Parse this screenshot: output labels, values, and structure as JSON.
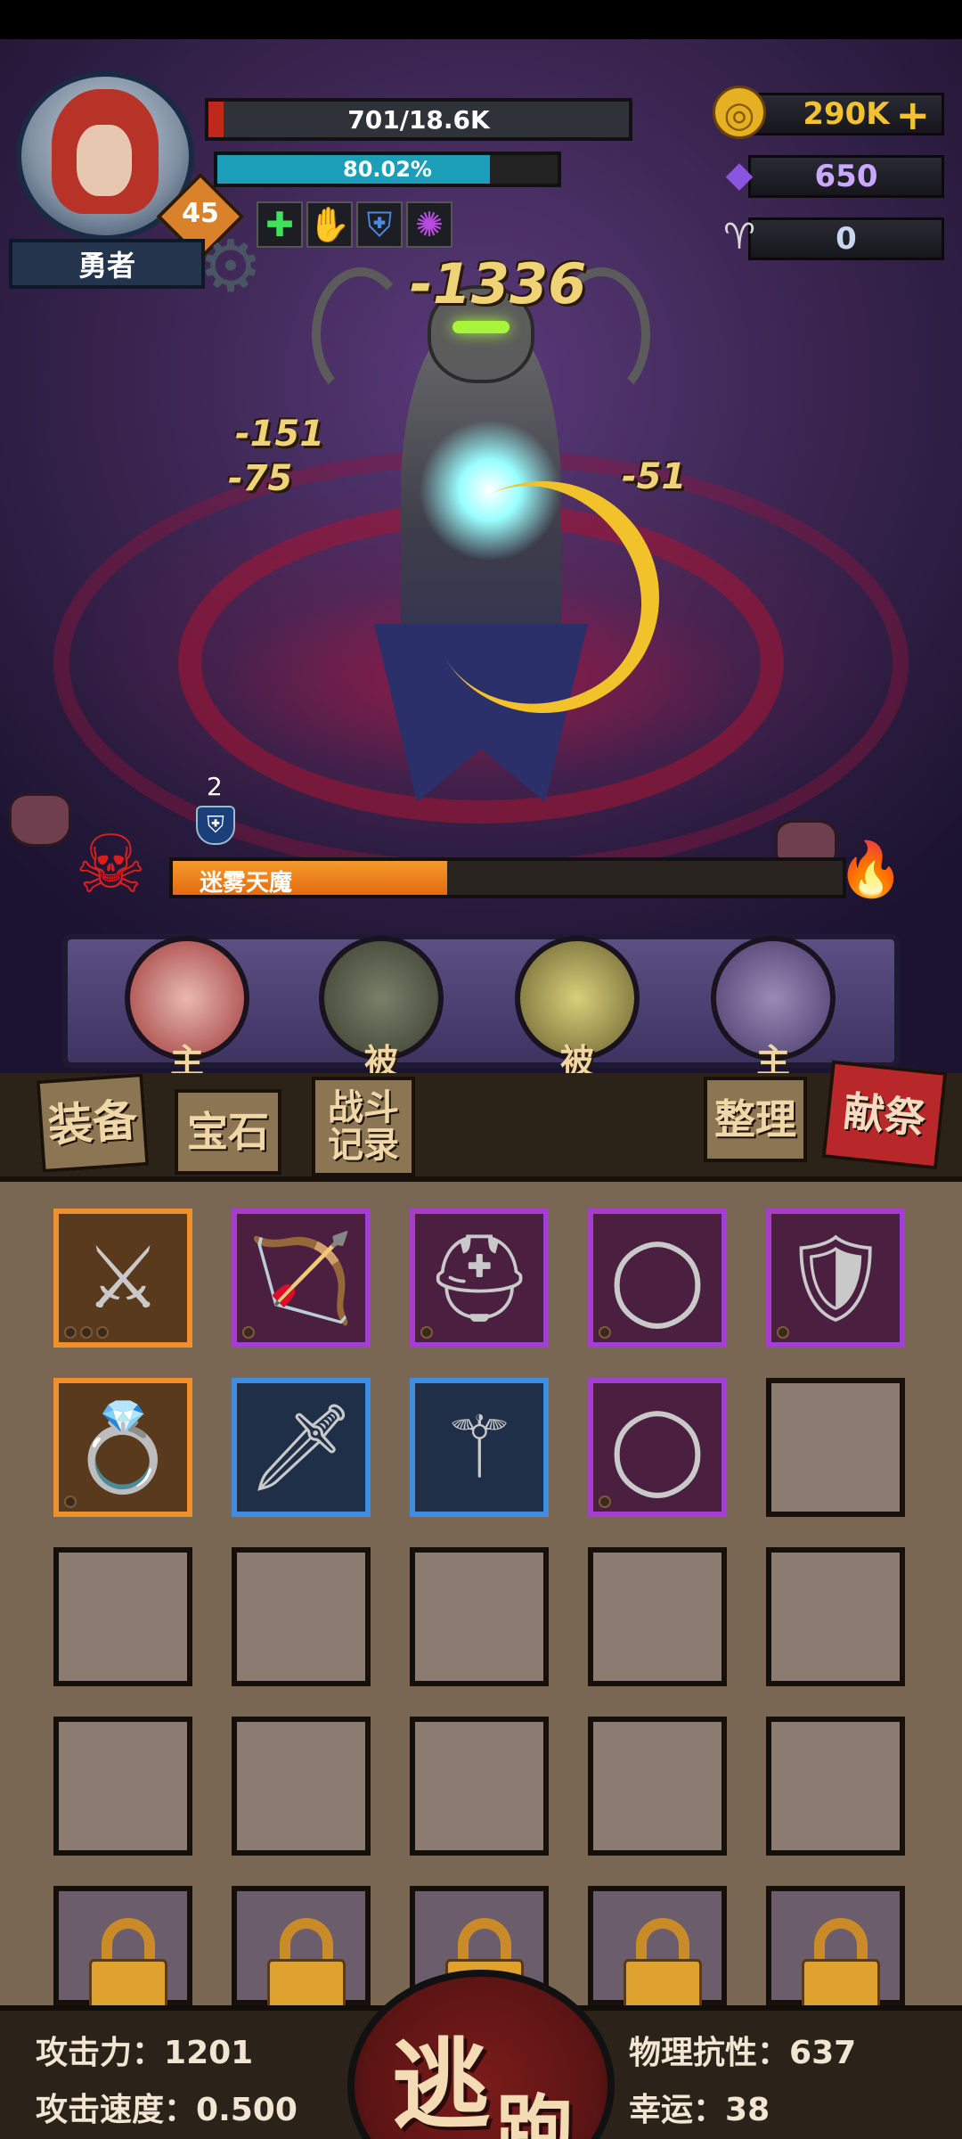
{
  "player": {
    "name": "勇者",
    "level": "45",
    "hp_text": "701/18.6K",
    "hp_fraction": 0.037,
    "exp_text": "80.02%",
    "exp_fraction": 0.8002
  },
  "buffs": [
    "heal-plus-icon",
    "attack-up-icon",
    "defense-down-icon",
    "vortex-icon"
  ],
  "currencies": [
    {
      "icon": "gold-coin-icon",
      "value": "290K"
    },
    {
      "icon": "purple-crystal-icon",
      "value": "650"
    },
    {
      "icon": "ram-skull-icon",
      "value": "0"
    }
  ],
  "damage_numbers": [
    "-1336",
    "-151",
    "-75",
    "-51"
  ],
  "boss": {
    "name": "迷雾天魔",
    "hp_fraction": 0.41,
    "shield_stack": "2"
  },
  "skills": [
    {
      "icon": "claw-blade-icon",
      "tag": "主"
    },
    {
      "icon": "wolf-icon",
      "tag": "被"
    },
    {
      "icon": "serpent-ring-icon",
      "tag": "被"
    },
    {
      "icon": "angel-wings-icon",
      "tag": "主"
    }
  ],
  "tabs": {
    "equipment": "装备",
    "gems": "宝石",
    "battle_log": "战斗记录",
    "sort": "整理",
    "sacrifice": "献祭"
  },
  "inventory": [
    {
      "rarity": "orange",
      "icon": "chain-mace-icon"
    },
    {
      "rarity": "purple",
      "icon": "bow-icon"
    },
    {
      "rarity": "purple",
      "icon": "helmet-icon"
    },
    {
      "rarity": "purple",
      "icon": "belt-icon"
    },
    {
      "rarity": "purple",
      "icon": "dragon-shield-icon"
    },
    {
      "rarity": "orange",
      "icon": "spiked-ring-icon"
    },
    {
      "rarity": "blue",
      "icon": "spear-icon"
    },
    {
      "rarity": "blue",
      "icon": "lance-icon"
    },
    {
      "rarity": "purple",
      "icon": "silver-belt-icon"
    }
  ],
  "stats": {
    "attack_label": "攻击力：",
    "attack_value": "1201",
    "attack_speed_label": "攻击速度：",
    "attack_speed_value": "0.500",
    "phys_res_label": "物理抗性：",
    "phys_res_value": "637",
    "luck_label": "幸运：",
    "luck_value": "38"
  },
  "flee": {
    "char1": "逃",
    "char2": "跑"
  }
}
